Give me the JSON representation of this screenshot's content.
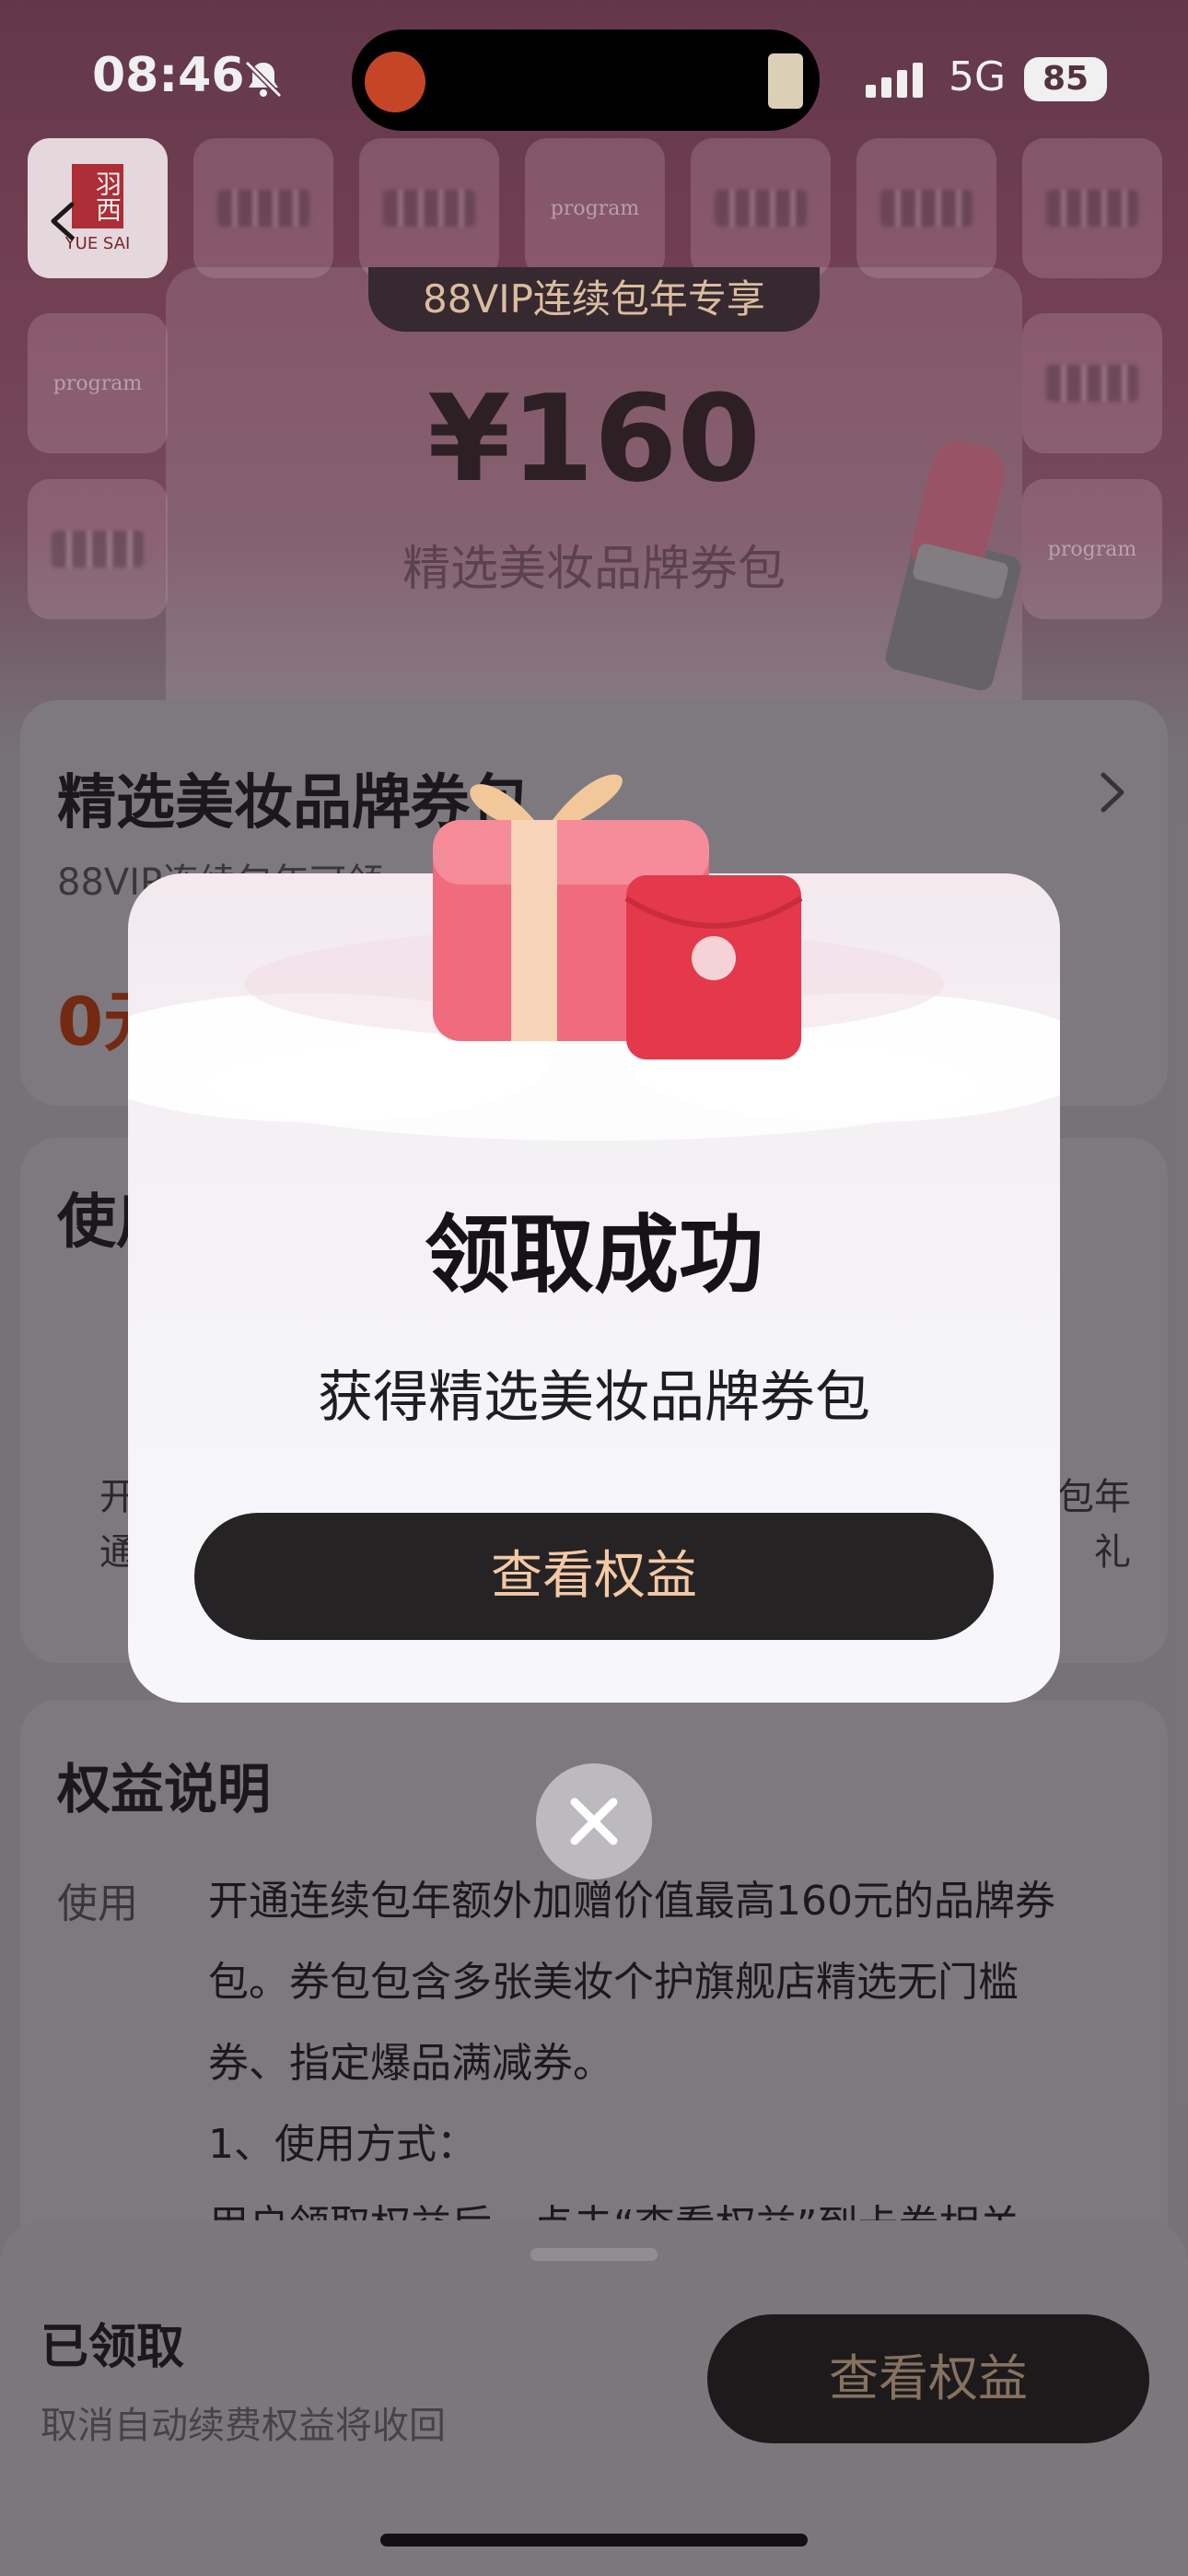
{
  "status_bar": {
    "time": "08:46",
    "network": "5G",
    "battery": "85",
    "icons": [
      "bell-muted-icon",
      "signal-icon",
      "battery-icon"
    ]
  },
  "hero": {
    "tile_logo_text": "YUE SAI",
    "tile_logo_cn": "羽西",
    "tile_dp_text": "program",
    "vip_label": "88VIP连续包年专享",
    "amount": "¥160",
    "subtitle": "精选美妆品牌券包"
  },
  "card1": {
    "title": "精选美妆品牌券包",
    "subtitle": "88VIP连续包年可领",
    "price": "0元"
  },
  "card2": {
    "title": "使用",
    "left_text_1": "开",
    "left_text_2": "通",
    "right_text_1": "包年",
    "right_text_2": "礼"
  },
  "benefits": {
    "title": "权益说明",
    "tag": "使用",
    "body_1": "开通连续包年额外加赠价值最高160元的品牌券",
    "body_2": "包。券包包含多张美妆个护旗舰店精选无门槛",
    "body_3": "券、指定爆品满减券。",
    "body_4": "1、使用方式：",
    "body_5": "用户领取权益后，点击“查看权益”到卡券相关"
  },
  "bottom_bar": {
    "status": "已领取",
    "note": "取消自动续费权益将收回",
    "button": "查看权益"
  },
  "modal": {
    "title": "领取成功",
    "subtitle": "获得精选美妆品牌券包",
    "button": "查看权益"
  },
  "colors": {
    "modal_button_bg": "#262325",
    "modal_button_text": "#f3c9a5",
    "price_color": "#7b2c14"
  }
}
